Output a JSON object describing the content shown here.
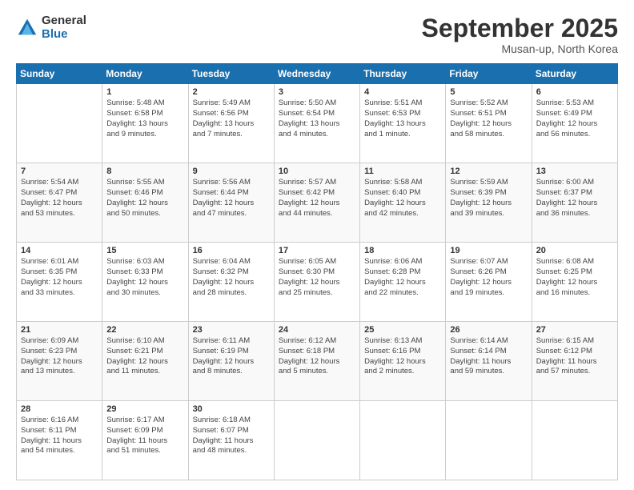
{
  "logo": {
    "general": "General",
    "blue": "Blue"
  },
  "header": {
    "month": "September 2025",
    "location": "Musan-up, North Korea"
  },
  "days": [
    "Sunday",
    "Monday",
    "Tuesday",
    "Wednesday",
    "Thursday",
    "Friday",
    "Saturday"
  ],
  "weeks": [
    [
      {
        "day": "",
        "content": ""
      },
      {
        "day": "1",
        "content": "Sunrise: 5:48 AM\nSunset: 6:58 PM\nDaylight: 13 hours\nand 9 minutes."
      },
      {
        "day": "2",
        "content": "Sunrise: 5:49 AM\nSunset: 6:56 PM\nDaylight: 13 hours\nand 7 minutes."
      },
      {
        "day": "3",
        "content": "Sunrise: 5:50 AM\nSunset: 6:54 PM\nDaylight: 13 hours\nand 4 minutes."
      },
      {
        "day": "4",
        "content": "Sunrise: 5:51 AM\nSunset: 6:53 PM\nDaylight: 13 hours\nand 1 minute."
      },
      {
        "day": "5",
        "content": "Sunrise: 5:52 AM\nSunset: 6:51 PM\nDaylight: 12 hours\nand 58 minutes."
      },
      {
        "day": "6",
        "content": "Sunrise: 5:53 AM\nSunset: 6:49 PM\nDaylight: 12 hours\nand 56 minutes."
      }
    ],
    [
      {
        "day": "7",
        "content": "Sunrise: 5:54 AM\nSunset: 6:47 PM\nDaylight: 12 hours\nand 53 minutes."
      },
      {
        "day": "8",
        "content": "Sunrise: 5:55 AM\nSunset: 6:46 PM\nDaylight: 12 hours\nand 50 minutes."
      },
      {
        "day": "9",
        "content": "Sunrise: 5:56 AM\nSunset: 6:44 PM\nDaylight: 12 hours\nand 47 minutes."
      },
      {
        "day": "10",
        "content": "Sunrise: 5:57 AM\nSunset: 6:42 PM\nDaylight: 12 hours\nand 44 minutes."
      },
      {
        "day": "11",
        "content": "Sunrise: 5:58 AM\nSunset: 6:40 PM\nDaylight: 12 hours\nand 42 minutes."
      },
      {
        "day": "12",
        "content": "Sunrise: 5:59 AM\nSunset: 6:39 PM\nDaylight: 12 hours\nand 39 minutes."
      },
      {
        "day": "13",
        "content": "Sunrise: 6:00 AM\nSunset: 6:37 PM\nDaylight: 12 hours\nand 36 minutes."
      }
    ],
    [
      {
        "day": "14",
        "content": "Sunrise: 6:01 AM\nSunset: 6:35 PM\nDaylight: 12 hours\nand 33 minutes."
      },
      {
        "day": "15",
        "content": "Sunrise: 6:03 AM\nSunset: 6:33 PM\nDaylight: 12 hours\nand 30 minutes."
      },
      {
        "day": "16",
        "content": "Sunrise: 6:04 AM\nSunset: 6:32 PM\nDaylight: 12 hours\nand 28 minutes."
      },
      {
        "day": "17",
        "content": "Sunrise: 6:05 AM\nSunset: 6:30 PM\nDaylight: 12 hours\nand 25 minutes."
      },
      {
        "day": "18",
        "content": "Sunrise: 6:06 AM\nSunset: 6:28 PM\nDaylight: 12 hours\nand 22 minutes."
      },
      {
        "day": "19",
        "content": "Sunrise: 6:07 AM\nSunset: 6:26 PM\nDaylight: 12 hours\nand 19 minutes."
      },
      {
        "day": "20",
        "content": "Sunrise: 6:08 AM\nSunset: 6:25 PM\nDaylight: 12 hours\nand 16 minutes."
      }
    ],
    [
      {
        "day": "21",
        "content": "Sunrise: 6:09 AM\nSunset: 6:23 PM\nDaylight: 12 hours\nand 13 minutes."
      },
      {
        "day": "22",
        "content": "Sunrise: 6:10 AM\nSunset: 6:21 PM\nDaylight: 12 hours\nand 11 minutes."
      },
      {
        "day": "23",
        "content": "Sunrise: 6:11 AM\nSunset: 6:19 PM\nDaylight: 12 hours\nand 8 minutes."
      },
      {
        "day": "24",
        "content": "Sunrise: 6:12 AM\nSunset: 6:18 PM\nDaylight: 12 hours\nand 5 minutes."
      },
      {
        "day": "25",
        "content": "Sunrise: 6:13 AM\nSunset: 6:16 PM\nDaylight: 12 hours\nand 2 minutes."
      },
      {
        "day": "26",
        "content": "Sunrise: 6:14 AM\nSunset: 6:14 PM\nDaylight: 11 hours\nand 59 minutes."
      },
      {
        "day": "27",
        "content": "Sunrise: 6:15 AM\nSunset: 6:12 PM\nDaylight: 11 hours\nand 57 minutes."
      }
    ],
    [
      {
        "day": "28",
        "content": "Sunrise: 6:16 AM\nSunset: 6:11 PM\nDaylight: 11 hours\nand 54 minutes."
      },
      {
        "day": "29",
        "content": "Sunrise: 6:17 AM\nSunset: 6:09 PM\nDaylight: 11 hours\nand 51 minutes."
      },
      {
        "day": "30",
        "content": "Sunrise: 6:18 AM\nSunset: 6:07 PM\nDaylight: 11 hours\nand 48 minutes."
      },
      {
        "day": "",
        "content": ""
      },
      {
        "day": "",
        "content": ""
      },
      {
        "day": "",
        "content": ""
      },
      {
        "day": "",
        "content": ""
      }
    ]
  ]
}
